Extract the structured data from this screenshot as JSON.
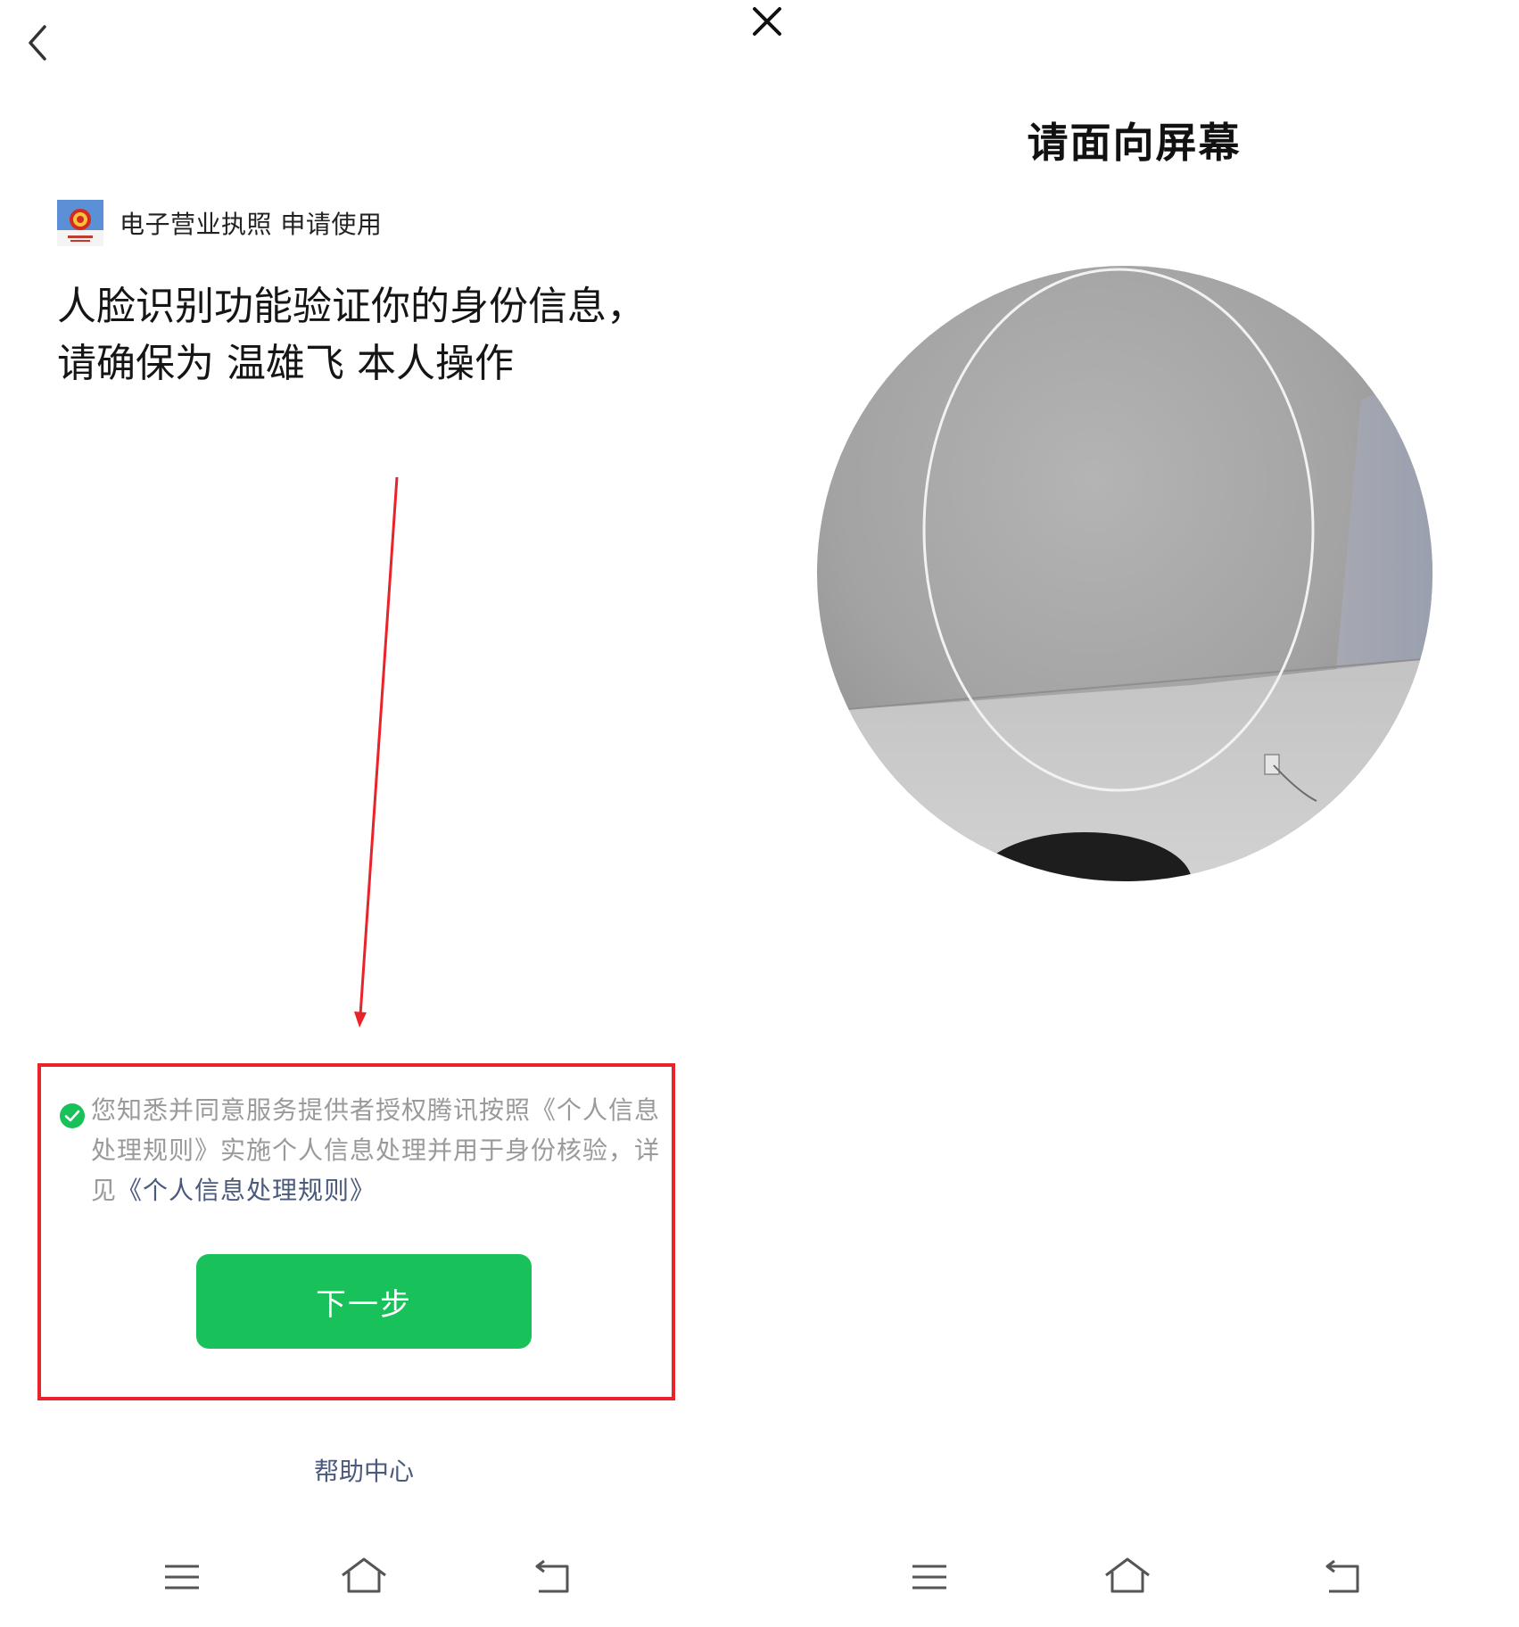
{
  "left": {
    "app": {
      "logo_icon": "national-emblem-icon",
      "request_text": "电子营业执照 申请使用"
    },
    "headline": {
      "line1": "人脸识别功能验证你的身份信息，",
      "line2": "请确保为 温雄飞 本人操作"
    },
    "consent": {
      "checked": true,
      "text_prefix": "您知悉并同意服务提供者授权腾讯按照《个人信息处理规则》实施个人信息处理并用于身份核验，详见",
      "link_text": "《个人信息处理规则》"
    },
    "next_button_label": "下一步",
    "help_label": "帮助中心"
  },
  "right": {
    "title": "请面向屏幕"
  },
  "colors": {
    "primary_green": "#18c15a",
    "link_blue": "#4a5a7c",
    "annotation_red": "#e8232a",
    "muted_text": "#9a9a9a"
  },
  "icons": {
    "back": "chevron-left-icon",
    "close": "close-icon",
    "nav_menu": "menu-icon",
    "nav_home": "home-icon",
    "nav_back": "return-icon",
    "consent": "check-circle-icon"
  }
}
